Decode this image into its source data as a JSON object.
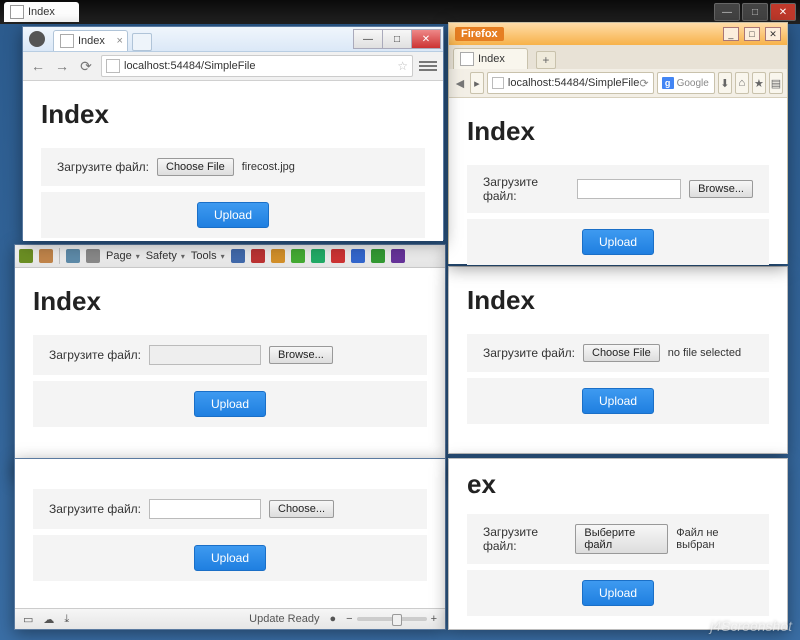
{
  "topTab": {
    "title": "Index"
  },
  "windows": {
    "chrome": {
      "tabTitle": "Index",
      "url": "localhost:54484/SimpleFile",
      "page": {
        "heading": "Index",
        "label": "Загрузите файл:",
        "chooseBtn": "Choose File",
        "fileName": "firecost.jpg",
        "uploadBtn": "Upload"
      }
    },
    "firefox": {
      "brand": "Firefox",
      "tabTitle": "Index",
      "url": "localhost:54484/SimpleFile",
      "searchPlaceholder": "Google",
      "page": {
        "heading": "Index",
        "label": "Загрузите файл:",
        "browseBtn": "Browse...",
        "uploadBtn": "Upload"
      }
    },
    "ie": {
      "menus": {
        "page": "Page",
        "safety": "Safety",
        "tools": "Tools"
      },
      "page": {
        "heading": "Index",
        "label": "Загрузите файл:",
        "browseBtn": "Browse...",
        "uploadBtn": "Upload"
      }
    },
    "safari": {
      "page": {
        "heading": "Index",
        "label": "Загрузите файл:",
        "chooseBtn": "Choose File",
        "fileHint": "no file selected",
        "uploadBtn": "Upload"
      }
    },
    "bottomLeft": {
      "page": {
        "label": "Загрузите файл:",
        "chooseBtn": "Choose...",
        "uploadBtn": "Upload"
      },
      "status": "Update Ready"
    },
    "bottomRight": {
      "page": {
        "headingFragment": "ex",
        "label": "Загрузите файл:",
        "chooseBtn": "Выберите файл",
        "fileHint": "Файл не выбран",
        "uploadBtn": "Upload"
      }
    }
  },
  "watermark": "j4Screenshot"
}
